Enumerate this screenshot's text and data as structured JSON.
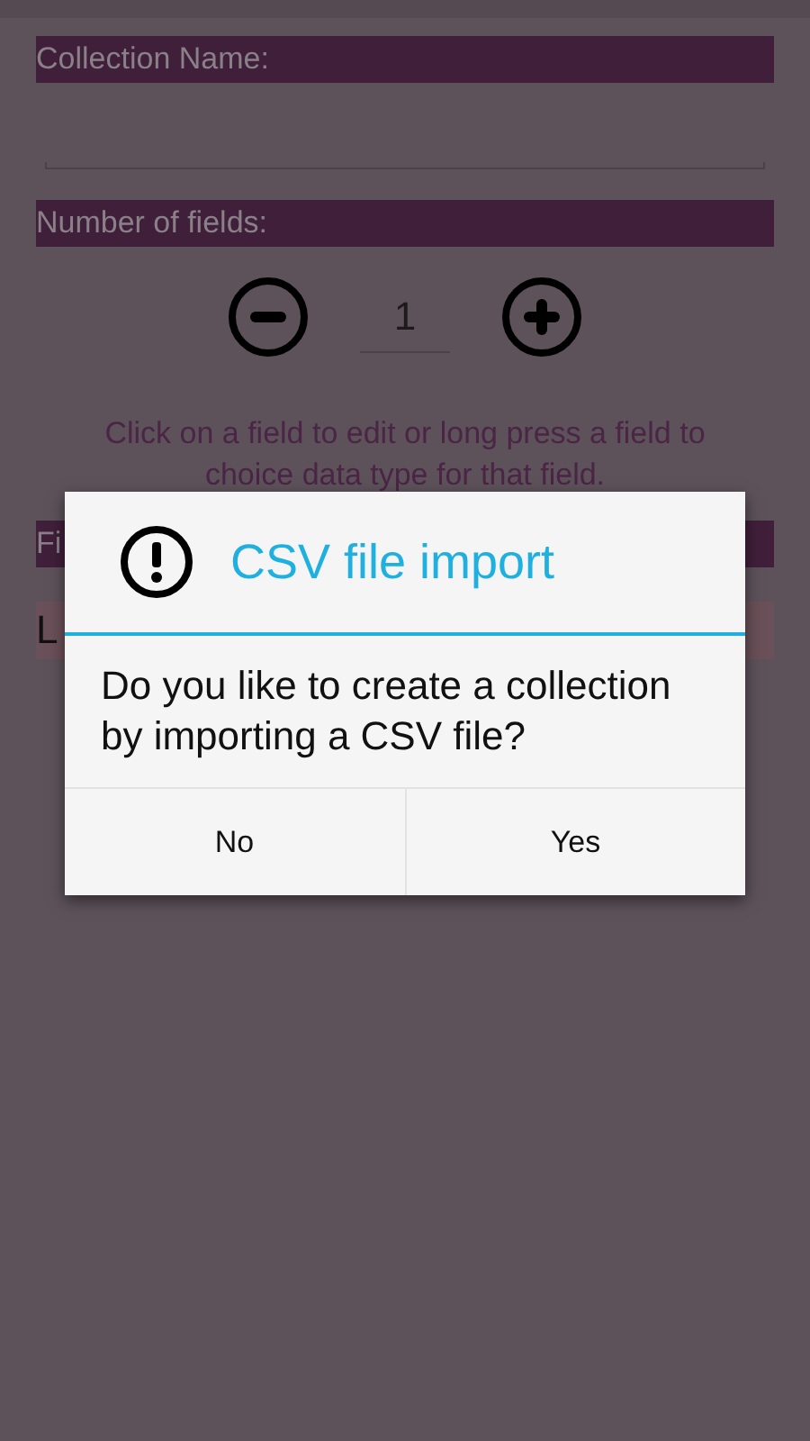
{
  "form": {
    "name_label": "Collection Name:",
    "count_label": "Number of fields:",
    "count": "1",
    "hint": "Click on a field to edit or long press a field to choice data type for that field.",
    "fields_label": "Fi",
    "field_row": "L"
  },
  "dialog": {
    "title": "CSV file import",
    "message": "Do you like to create a collection by importing a CSV file?",
    "buttons": [
      "No",
      "Yes"
    ]
  }
}
